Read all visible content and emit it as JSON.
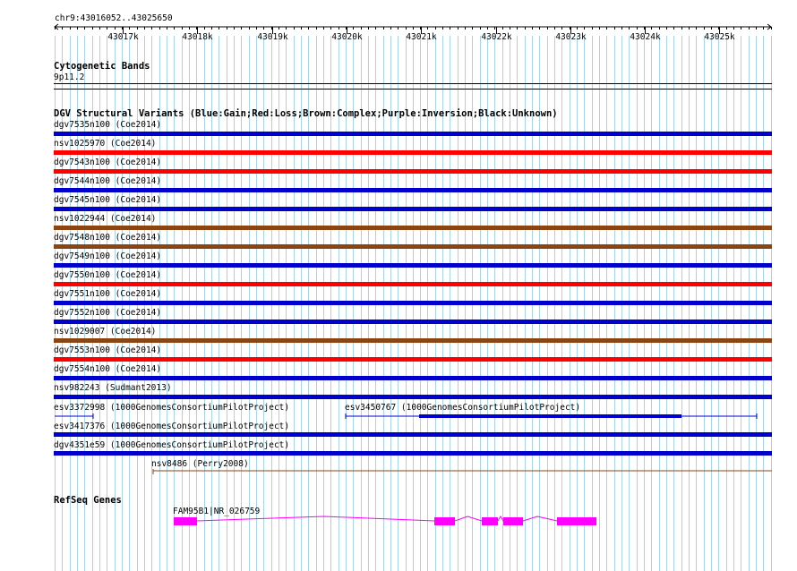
{
  "ruler": {
    "position": "chr9:43016052..43025650",
    "ticks": [
      "43017k",
      "43018k",
      "43019k",
      "43020k",
      "43021k",
      "43022k",
      "43023k",
      "43024k",
      "43025k"
    ]
  },
  "cytoband": {
    "title": "Cytogenetic Bands",
    "band": "9p11.2"
  },
  "dgv": {
    "title": "DGV Structural Variants (Blue:Gain;Red:Loss;Brown:Complex;Purple:Inversion;Black:Unknown)",
    "colors": {
      "gain": "#0000cc",
      "loss": "#ff0000",
      "complex": "#8b4513",
      "thin": "#0000cc"
    },
    "full_rows": [
      {
        "label": "dgv7535n100 (Coe2014)",
        "type": "gain"
      },
      {
        "label": "nsv1025970 (Coe2014)",
        "type": "loss"
      },
      {
        "label": "dgv7543n100 (Coe2014)",
        "type": "loss"
      },
      {
        "label": "dgv7544n100 (Coe2014)",
        "type": "gain"
      },
      {
        "label": "dgv7545n100 (Coe2014)",
        "type": "gain"
      },
      {
        "label": "nsv1022944 (Coe2014)",
        "type": "complex"
      },
      {
        "label": "dgv7548n100 (Coe2014)",
        "type": "complex"
      },
      {
        "label": "dgv7549n100 (Coe2014)",
        "type": "gain"
      },
      {
        "label": "dgv7550n100 (Coe2014)",
        "type": "loss"
      },
      {
        "label": "dgv7551n100 (Coe2014)",
        "type": "gain"
      },
      {
        "label": "dgv7552n100 (Coe2014)",
        "type": "gain"
      },
      {
        "label": "nsv1029007 (Coe2014)",
        "type": "complex"
      },
      {
        "label": "dgv7553n100 (Coe2014)",
        "type": "loss"
      },
      {
        "label": "dgv7554n100 (Coe2014)",
        "type": "gain"
      },
      {
        "label": "nsv982243 (Sudmant2013)",
        "type": "gain"
      }
    ],
    "esv3372998": "esv3372998 (1000GenomesConsortiumPilotProject)",
    "esv3450767": "esv3450767 (1000GenomesConsortiumPilotProject)",
    "esv3417376": "esv3417376 (1000GenomesConsortiumPilotProject)",
    "dgv4351e59": "dgv4351e59 (1000GenomesConsortiumPilotProject)",
    "nsv8486": "nsv8486 (Perry2008)"
  },
  "refseq": {
    "title": "RefSeq Genes",
    "gene_label": "FAM95B1|NR_026759",
    "color": "#ff00ff"
  },
  "grid_color": "#a8d4e6"
}
